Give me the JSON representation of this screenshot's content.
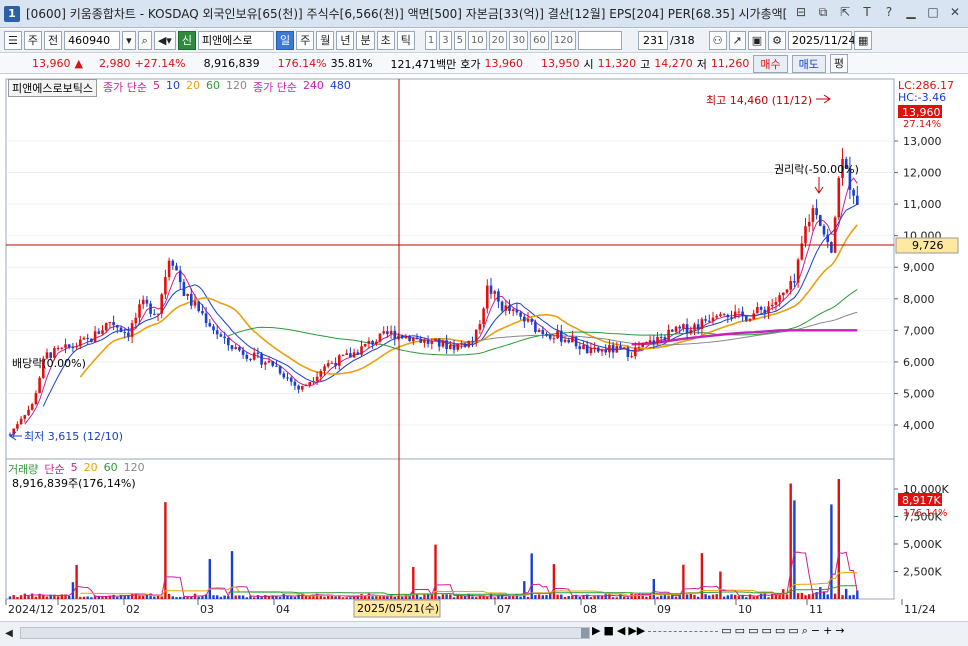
{
  "window": {
    "badge": "1",
    "title": "[0600] 키움종합차트 - KOSDAQ 외국인보유[65(천)] 주식수[6,566(천)] 액면[500] 자본금[33(억)] 결산[12월] EPS[204] PER[68.35] 시가총액[",
    "buttons": [
      "⊟",
      "⧉",
      "⇱",
      "T",
      "?",
      "▁",
      "□",
      "✕"
    ]
  },
  "toolbar": {
    "period_prefix": "주",
    "prev": "전",
    "code": "460940",
    "stock_tag": "신",
    "stock_name": "피앤에스로",
    "periods": [
      "일",
      "주",
      "월",
      "년",
      "분",
      "초",
      "틱"
    ],
    "selected_period": "일",
    "minutes": [
      "1",
      "3",
      "5",
      "10",
      "20",
      "30",
      "60",
      "120"
    ],
    "count": "231",
    "total": "/318",
    "date": "2025/11/24"
  },
  "infobar": {
    "price": "13,960",
    "arrow": "▲",
    "change": "2,980",
    "change_pct": "+27.14%",
    "volume": "8,916,839",
    "vol_ratio": "176.14%",
    "turnover": "35.81%",
    "amount": "121,471백만",
    "bid_label": "호가",
    "ask": "13,960",
    "bid": "13,950",
    "open_label": "시",
    "open": "11,320",
    "high_label": "고",
    "high": "14,270",
    "low_label": "저",
    "low": "11,260",
    "sell_btn": "매수",
    "buy_btn": "매도",
    "pyeong": "평"
  },
  "legend": {
    "stock": "피앤에스로보틱스",
    "ma_label": "종가 단순",
    "ma_periods": [
      "5",
      "10",
      "20",
      "60",
      "120"
    ],
    "ma2_label": "종가 단순",
    "ma2_periods": [
      "240",
      "480"
    ]
  },
  "volume_legend": {
    "label": "거래량",
    "ma_label": "단순",
    "periods": [
      "5",
      "20",
      "60",
      "120"
    ],
    "sub": "8,916,839주(176,14%)"
  },
  "annotations": {
    "high": "최고 14,460 (11/12)",
    "low": "최저 3,615 (12/10)",
    "rights": "권리락(-50.00%)",
    "dividend": "배당락(0.00%)",
    "lc": "LC:286.17",
    "hc": "HC:-3.46",
    "last_price": "13,960",
    "last_pct": "27.14%",
    "crosshair_price": "9,726",
    "crosshair_date": "2025/05/21(수)",
    "vol_last": "8,917K",
    "vol_pct": "176.14%"
  },
  "price_axis": [
    "13,000",
    "12,000",
    "11,000",
    "10,000",
    "9,000",
    "8,000",
    "7,000",
    "6,000",
    "5,000",
    "4,000"
  ],
  "volume_axis": [
    "10,000K",
    "7,500K",
    "5,000K",
    "2,500K"
  ],
  "date_axis": [
    "2024/12",
    "2025/01",
    "02",
    "03",
    "04",
    "07",
    "08",
    "09",
    "10",
    "11",
    "11/24"
  ],
  "colors": {
    "up": "#e01010",
    "down": "#1a3fd0",
    "ma5": "#c8209a",
    "ma10": "#1a3fd0",
    "ma20": "#e8a010",
    "ma60": "#2a9a3a",
    "ma120": "#888888",
    "ma240": "#c820b8",
    "cross": "#c00000"
  }
}
